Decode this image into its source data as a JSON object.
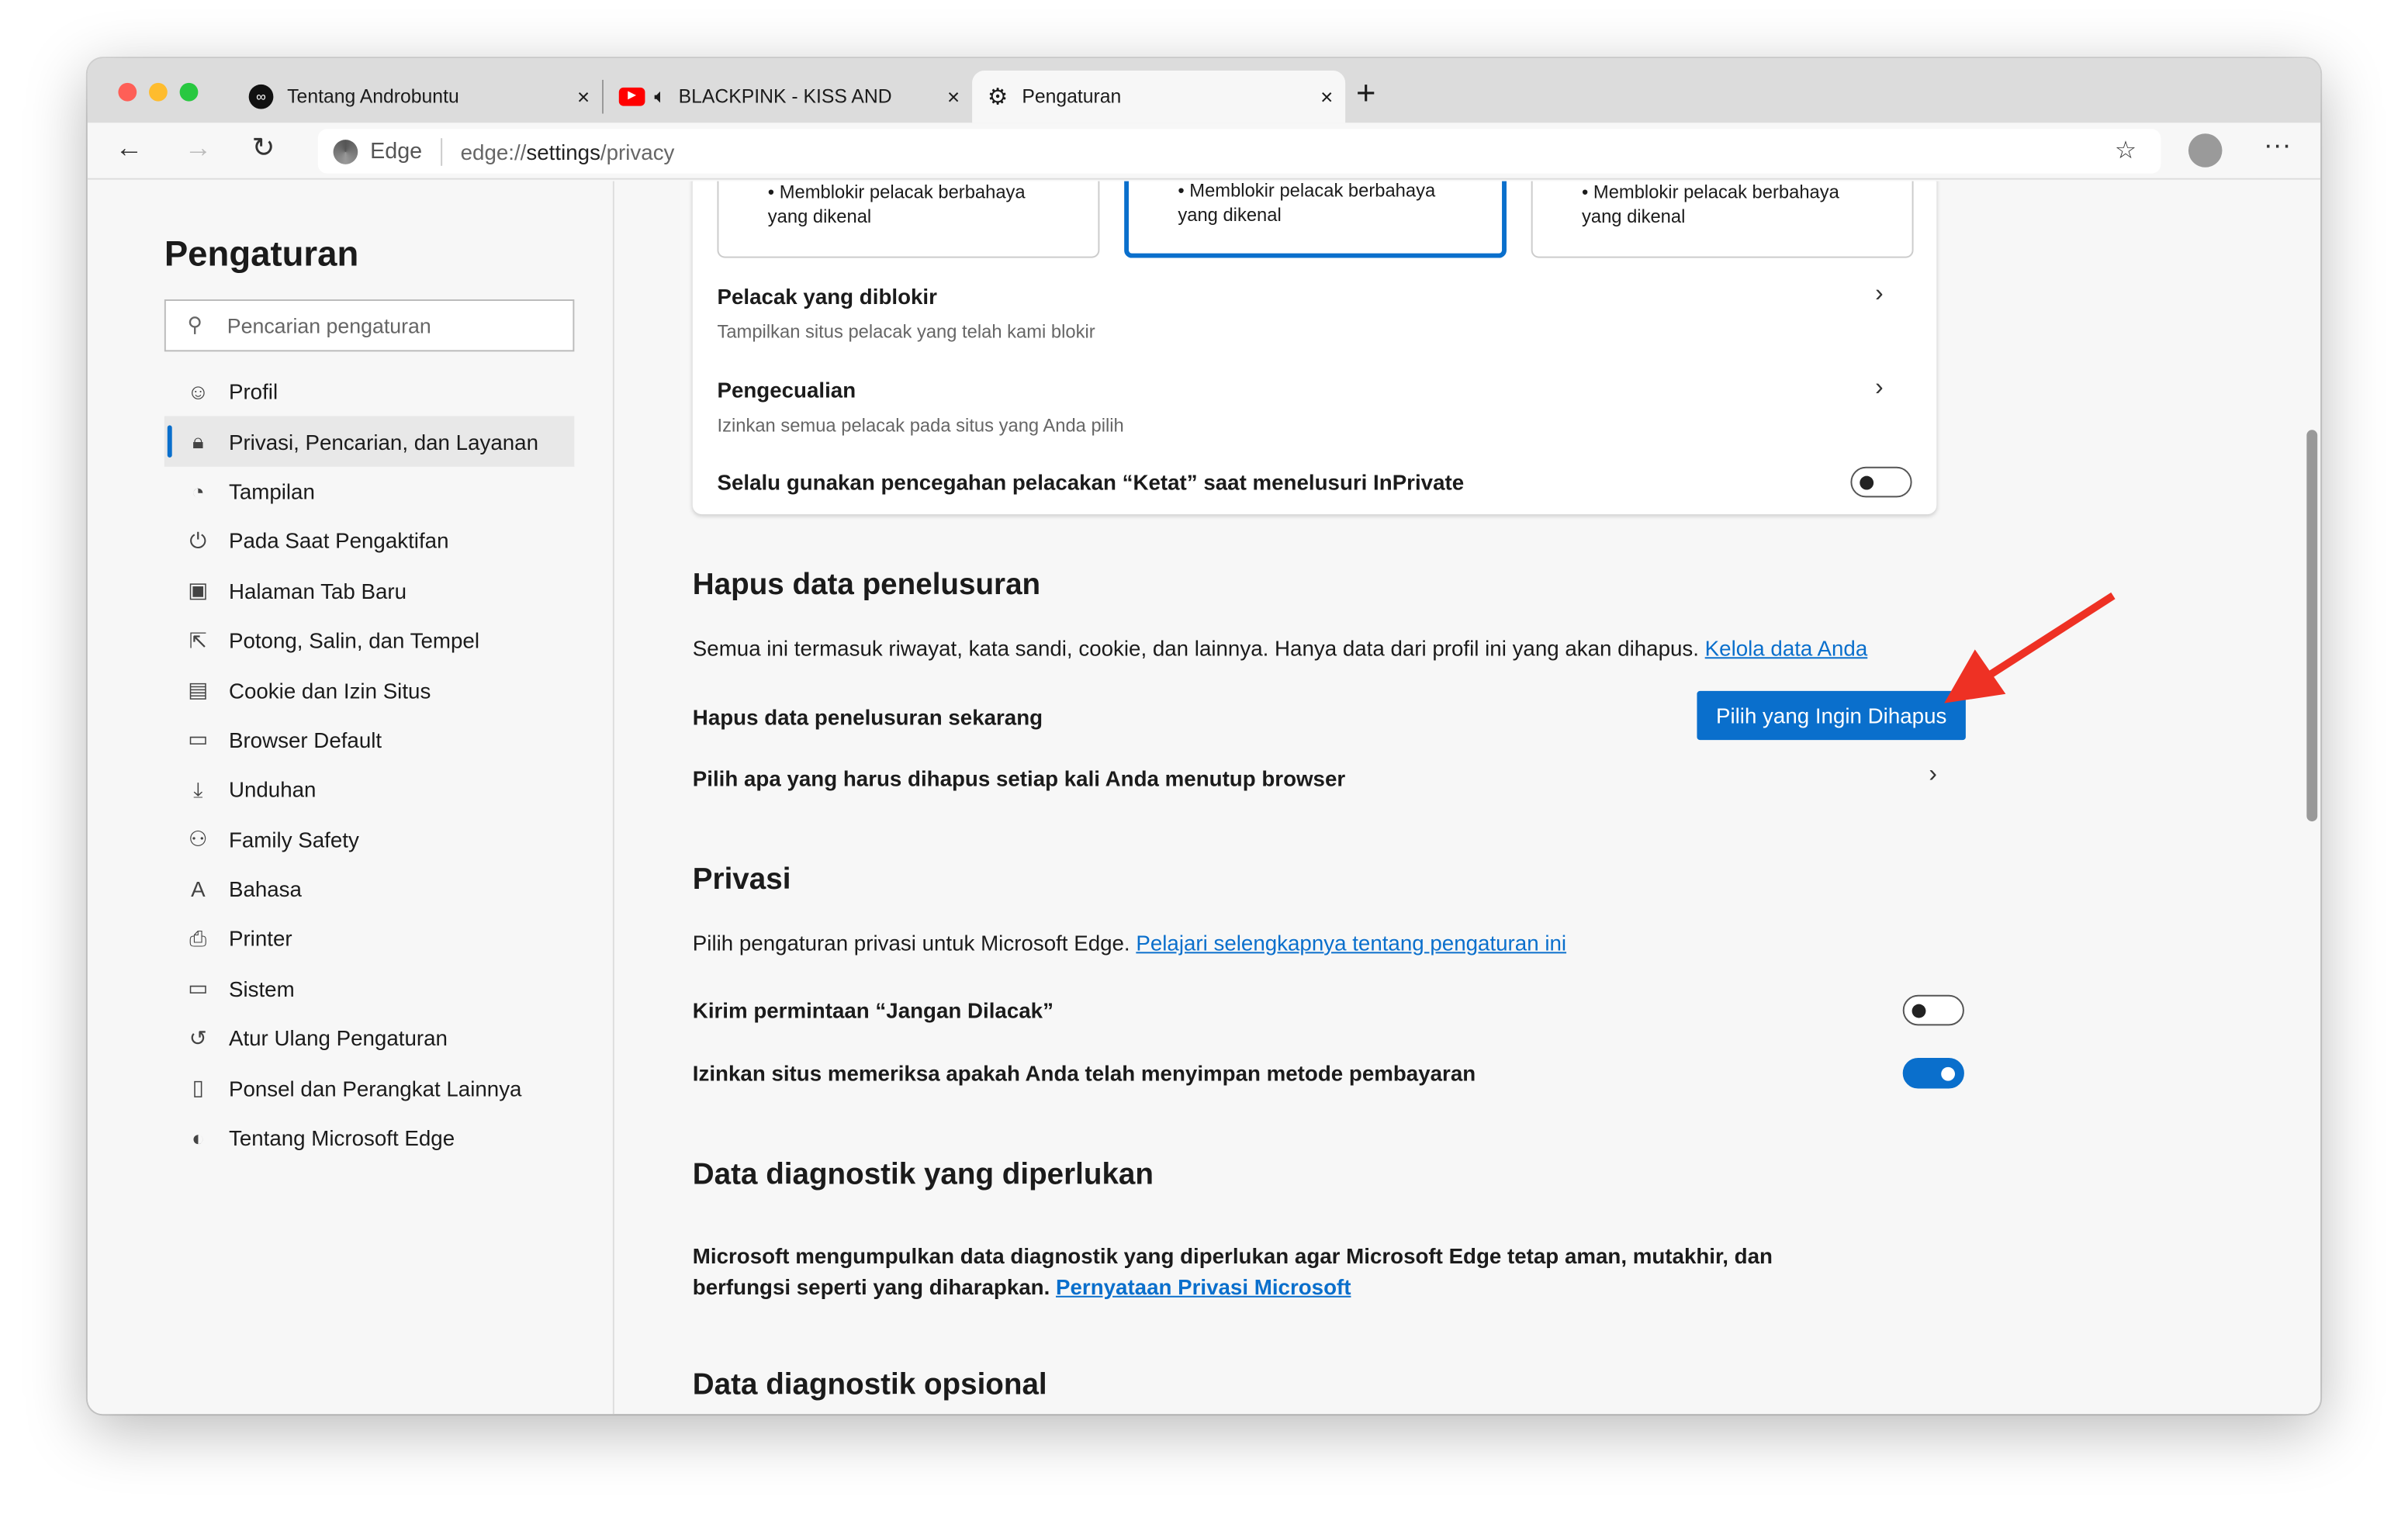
{
  "window": {
    "traffic_lights": [
      "#fe5f57",
      "#febc2e",
      "#28c840"
    ]
  },
  "tabs": [
    {
      "title": "Tentang Androbuntu",
      "icon": "androbuntu-logo-icon"
    },
    {
      "title": "BLACKPINK - KISS AND M",
      "icon": "youtube-icon",
      "audio": "speaker-icon"
    },
    {
      "title": "Pengaturan",
      "icon": "gear-icon",
      "active": true
    }
  ],
  "toolbar": {
    "site_label": "Edge",
    "url_prefix": "edge://",
    "url_host": "settings",
    "url_path": "/privacy"
  },
  "sidebar": {
    "title": "Pengaturan",
    "search_placeholder": "Pencarian pengaturan",
    "items": [
      {
        "label": "Profil",
        "icon": "profile-icon"
      },
      {
        "label": "Privasi, Pencarian, dan Layanan",
        "icon": "lock-icon",
        "selected": true
      },
      {
        "label": "Tampilan",
        "icon": "palette-icon"
      },
      {
        "label": "Pada Saat Pengaktifan",
        "icon": "power-icon"
      },
      {
        "label": "Halaman Tab Baru",
        "icon": "new-tab-icon"
      },
      {
        "label": "Potong, Salin, dan Tempel",
        "icon": "share-icon"
      },
      {
        "label": "Cookie dan Izin Situs",
        "icon": "cookie-icon"
      },
      {
        "label": "Browser Default",
        "icon": "browser-icon"
      },
      {
        "label": "Unduhan",
        "icon": "download-icon"
      },
      {
        "label": "Family Safety",
        "icon": "family-icon"
      },
      {
        "label": "Bahasa",
        "icon": "language-icon"
      },
      {
        "label": "Printer",
        "icon": "printer-icon"
      },
      {
        "label": "Sistem",
        "icon": "laptop-icon"
      },
      {
        "label": "Atur Ulang Pengaturan",
        "icon": "reset-icon"
      },
      {
        "label": "Ponsel dan Perangkat Lainnya",
        "icon": "phone-icon"
      },
      {
        "label": "Tentang Microsoft Edge",
        "icon": "edge-icon"
      }
    ]
  },
  "tracking": {
    "levels": [
      {
        "line1": "Memblokir pelacak berbahaya",
        "line2": "yang dikenal"
      },
      {
        "line1": "Memblokir pelacak berbahaya",
        "line2": "yang dikenal",
        "selected": true
      },
      {
        "line1": "Memblokir pelacak berbahaya",
        "line2": "yang dikenal"
      }
    ],
    "blocked_title": "Pelacak yang diblokir",
    "blocked_sub": "Tampilkan situs pelacak yang telah kami blokir",
    "exceptions_title": "Pengecualian",
    "exceptions_sub": "Izinkan semua pelacak pada situs yang Anda pilih",
    "strict_label": "Selalu gunakan pencegahan pelacakan “Ketat” saat menelusuri InPrivate",
    "strict_on": false
  },
  "clear": {
    "heading": "Hapus data penelusuran",
    "desc": "Semua ini termasuk riwayat, kata sandi, cookie, dan lainnya. Hanya data dari profil ini yang akan dihapus.",
    "link": "Kelola data Anda",
    "now_label": "Hapus data penelusuran sekarang",
    "button": "Pilih yang Ingin Dihapus",
    "on_close": "Pilih apa yang harus dihapus setiap kali Anda menutup browser"
  },
  "privacy": {
    "heading": "Privasi",
    "desc": "Pilih pengaturan privasi untuk Microsoft Edge.",
    "link": "Pelajari selengkapnya tentang pengaturan ini",
    "dnt_label": "Kirim permintaan “Jangan Dilacak”",
    "dnt_on": false,
    "payment_label": "Izinkan situs memeriksa apakah Anda telah menyimpan metode pembayaran",
    "payment_on": true
  },
  "diag": {
    "heading": "Data diagnostik yang diperlukan",
    "line1": "Microsoft mengumpulkan data diagnostik yang diperlukan agar Microsoft Edge tetap aman, mutakhir, dan",
    "line2": "berfungsi seperti yang diharapkan.",
    "link": "Pernyataan Privasi Microsoft",
    "optional_heading": "Data diagnostik opsional"
  },
  "annotation": {
    "arrow_color": "#ee3124"
  }
}
